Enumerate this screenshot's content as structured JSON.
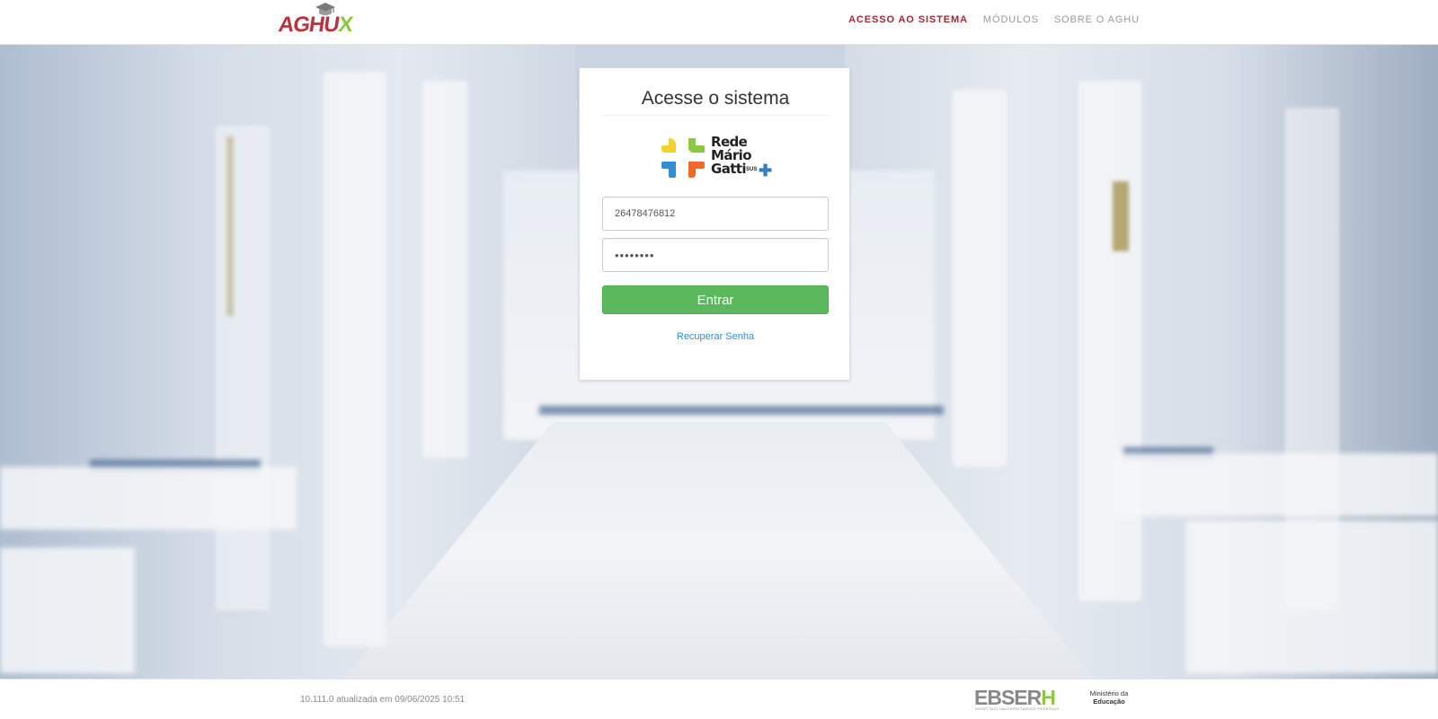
{
  "header": {
    "logo_text_main": "AGHU",
    "logo_text_x": "X",
    "nav": [
      {
        "label": "ACESSO AO SISTEMA",
        "active": true
      },
      {
        "label": "MÓDULOS",
        "active": false
      },
      {
        "label": "SOBRE O AGHU",
        "active": false
      }
    ]
  },
  "login": {
    "title": "Acesse o sistema",
    "brand_logo_lines": [
      "Rede",
      "Mário",
      "Gatti"
    ],
    "brand_sus": "SUS",
    "username_value": "26478476812",
    "password_value": "••••••••",
    "submit_label": "Entrar",
    "recover_label": "Recuperar Senha"
  },
  "footer": {
    "version": "10.111.0 atualizada em 09/06/2025 10:51",
    "ebserh_logo_word": "EBSER",
    "ebserh_logo_h": "H",
    "ebserh_logo_subtitle": "HOSPITAIS UNIVERSITÁRIOS FEDERAIS",
    "mec_line1": "Ministério da",
    "mec_line2": "Educação"
  },
  "colors": {
    "brand_red": "#a8262e",
    "brand_green": "#8dc63f",
    "button_green": "#5cb85c",
    "link_blue": "#2a8fd6"
  },
  "icons": [
    "graduation-cap-icon",
    "rede-mario-gatti-cross-icon",
    "sus-plus-icon"
  ]
}
